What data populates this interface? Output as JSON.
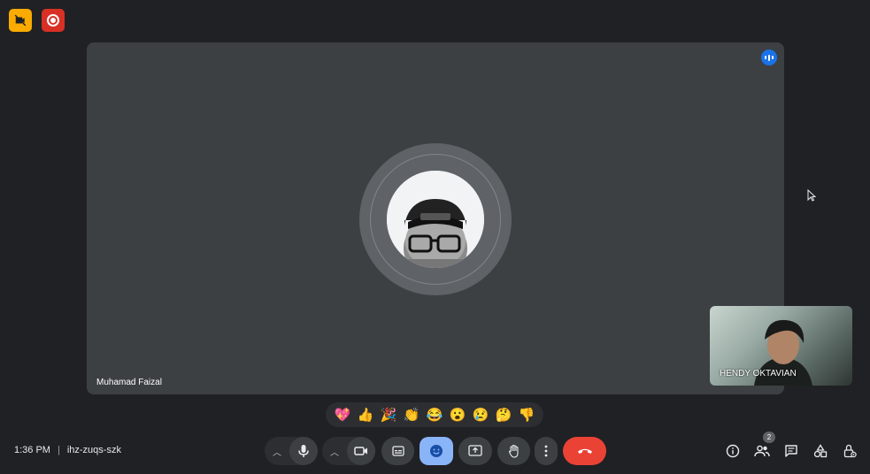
{
  "main_participant": {
    "name": "Muhamad Faizal"
  },
  "self_view": {
    "name": "HENDY OKTAVIAN"
  },
  "reactions": [
    "💖",
    "👍",
    "🎉",
    "👏",
    "😂",
    "😮",
    "😢",
    "🤔",
    "👎"
  ],
  "meeting": {
    "time": "1:36 PM",
    "separator": "|",
    "code": "ihz-zuqs-szk"
  },
  "people": {
    "count": "2"
  },
  "colors": {
    "background": "#202124",
    "tile": "#3c4043",
    "leave": "#ea4335",
    "emoji_active": "#8ab4f8",
    "speaking": "#1a73e8"
  }
}
